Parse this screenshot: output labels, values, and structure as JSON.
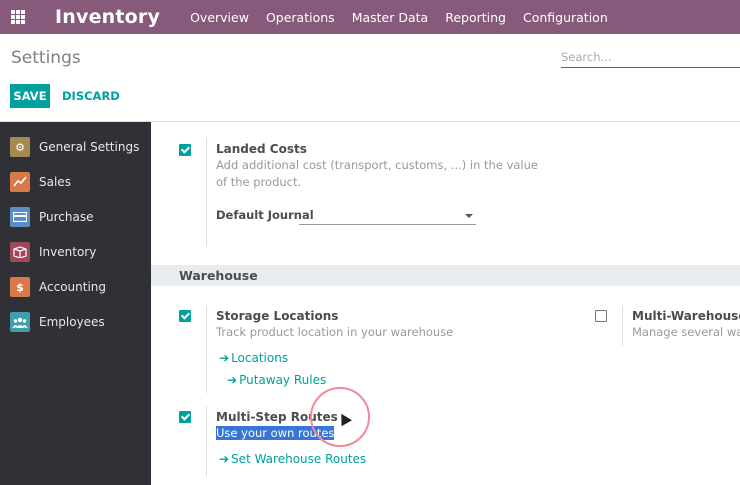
{
  "navbar": {
    "brand": "Inventory",
    "menu": [
      "Overview",
      "Operations",
      "Master Data",
      "Reporting",
      "Configuration"
    ],
    "background": "#875a7b"
  },
  "control_panel": {
    "title": "Settings",
    "search_placeholder": "Search...",
    "save_label": "SAVE",
    "discard_label": "DISCARD"
  },
  "sidebar": {
    "items": [
      {
        "label": "General Settings",
        "icon": "gear-icon",
        "color": "#a38a4f"
      },
      {
        "label": "Sales",
        "icon": "chart-icon",
        "color": "#d9794a"
      },
      {
        "label": "Purchase",
        "icon": "card-icon",
        "color": "#5b8ec4"
      },
      {
        "label": "Inventory",
        "icon": "box-icon",
        "color": "#a0485a"
      },
      {
        "label": "Accounting",
        "icon": "dollar-icon",
        "color": "#d9794a"
      },
      {
        "label": "Employees",
        "icon": "people-icon",
        "color": "#3e9eac"
      }
    ]
  },
  "settings": {
    "landed_costs": {
      "checked": true,
      "title": "Landed Costs",
      "description": "Add additional cost (transport, customs, ...) in the value of the product.",
      "journal_label": "Default Journal",
      "journal_value": ""
    },
    "warehouse_section": {
      "title": "Warehouse"
    },
    "storage_locations": {
      "checked": true,
      "title": "Storage Locations",
      "description": "Track product location in your warehouse",
      "links": [
        "Locations",
        "Putaway Rules"
      ]
    },
    "multi_warehouses": {
      "checked": false,
      "title": "Multi-Warehouses",
      "description": "Manage several warehouses"
    },
    "multi_step_routes": {
      "checked": true,
      "title": "Multi-Step Routes",
      "description": "Use your own routes",
      "links": [
        "Set Warehouse Routes"
      ]
    }
  },
  "colors": {
    "accent": "#00a09d",
    "sidebar_bg": "#2f3136",
    "highlight": "#3875d7"
  }
}
